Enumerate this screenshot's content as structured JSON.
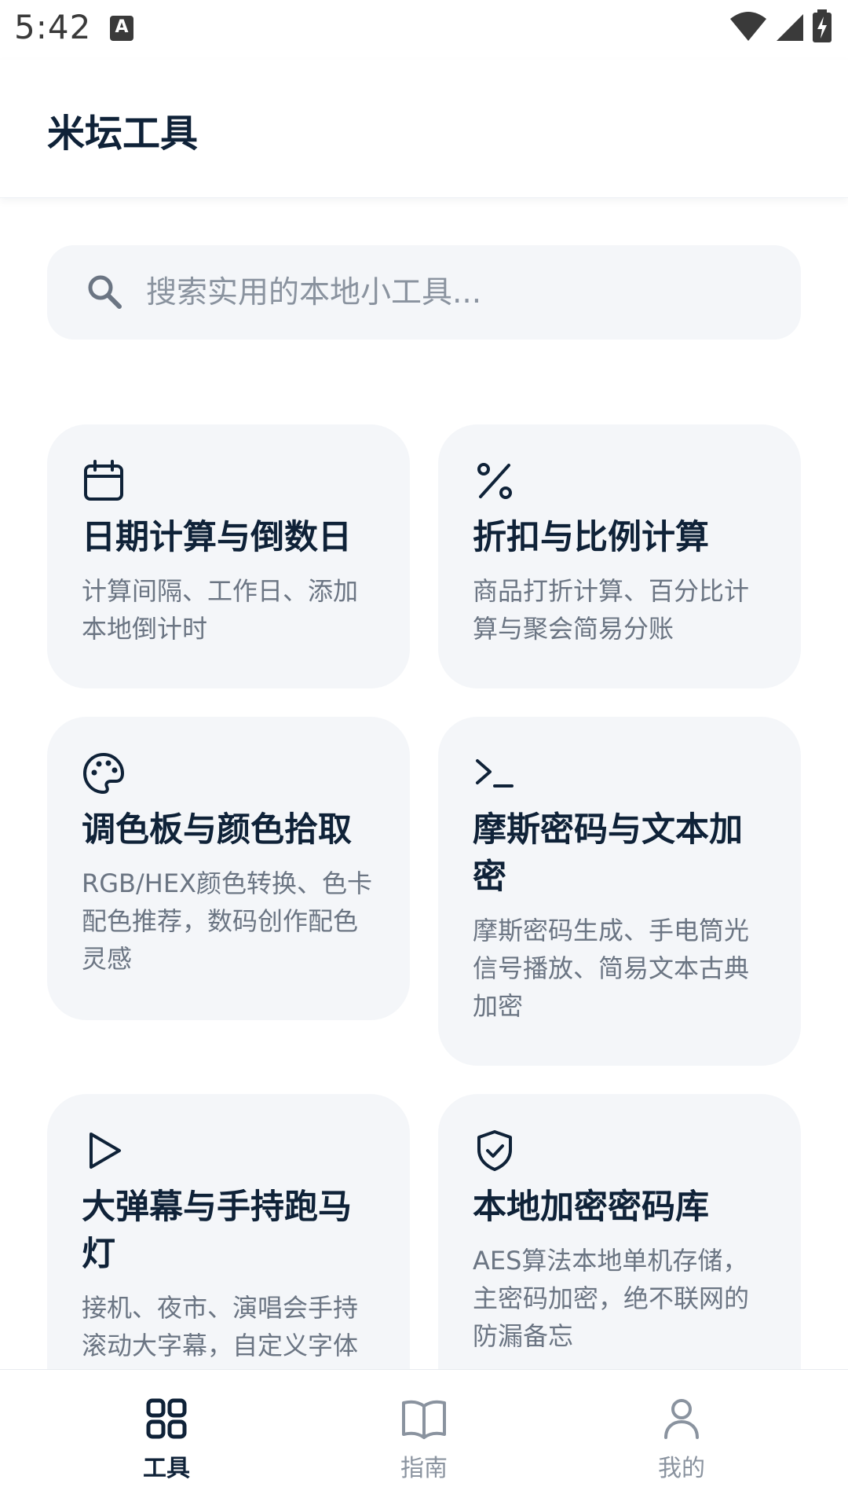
{
  "status_bar": {
    "time": "5:42",
    "notification_icon": "keyboard-a-icon",
    "right_icons": [
      "wifi-icon",
      "signal-icon",
      "battery-charging-icon"
    ]
  },
  "app_bar": {
    "title": "米坛工具"
  },
  "search": {
    "placeholder": "搜索实用的本地小工具...",
    "value": "",
    "icon": "search-icon"
  },
  "tools": [
    {
      "icon": "calendar-icon",
      "title": "日期计算与倒数日",
      "desc": "计算间隔、工作日、添加本地倒计时"
    },
    {
      "icon": "percent-icon",
      "title": "折扣与比例计算",
      "desc": "商品打折计算、百分比计算与聚会简易分账"
    },
    {
      "icon": "palette-icon",
      "title": "调色板与颜色拾取",
      "desc": "RGB/HEX颜色转换、色卡配色推荐，数码创作配色灵感"
    },
    {
      "icon": "terminal-icon",
      "title": "摩斯密码与文本加密",
      "desc": "摩斯密码生成、手电筒光信号播放、简易文本古典加密"
    },
    {
      "icon": "play-icon",
      "title": "大弹幕与手持跑马灯",
      "desc": "接机、夜市、演唱会手持滚动大字幕，自定义字体"
    },
    {
      "icon": "shield-check-icon",
      "title": "本地加密密码库",
      "desc": "AES算法本地单机存储，主密码加密，绝不联网的防漏备忘"
    }
  ],
  "bottom_nav": [
    {
      "label": "工具",
      "icon": "grid-icon",
      "active": true
    },
    {
      "label": "指南",
      "icon": "book-icon",
      "active": false
    },
    {
      "label": "我的",
      "icon": "person-icon",
      "active": false
    }
  ],
  "colors": {
    "primary_text": "#0f2238",
    "secondary_text": "#6b7583",
    "card_background": "#f4f6f9",
    "inactive_nav": "#8a939f"
  }
}
